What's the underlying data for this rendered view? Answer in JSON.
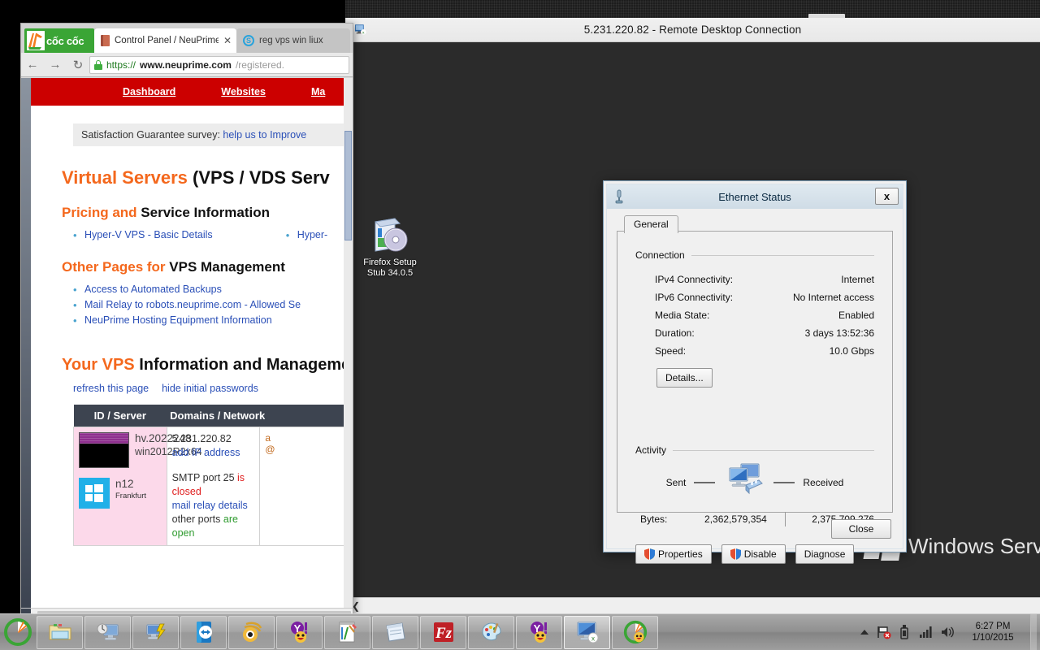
{
  "rdp": {
    "title": "5.231.220.82 - Remote Desktop Connection",
    "icon": "remote-desktop-icon",
    "desktop_icon": {
      "label_line1": "Firefox Setup",
      "label_line2": "Stub 34.0.5",
      "icon": "firefox-installer-icon"
    },
    "watermark": "Windows Serve"
  },
  "dialog": {
    "title": "Ethernet Status",
    "icon": "network-adapter-icon",
    "close_label": "x",
    "tab": "General",
    "connection": {
      "group_label": "Connection",
      "rows": [
        {
          "label": "IPv4 Connectivity:",
          "value": "Internet"
        },
        {
          "label": "IPv6 Connectivity:",
          "value": "No Internet access"
        },
        {
          "label": "Media State:",
          "value": "Enabled"
        },
        {
          "label": "Duration:",
          "value": "3 days 13:52:36"
        },
        {
          "label": "Speed:",
          "value": "10.0 Gbps"
        }
      ],
      "details_button": "Details..."
    },
    "activity": {
      "group_label": "Activity",
      "sent_label": "Sent",
      "received_label": "Received",
      "bytes_label": "Bytes:",
      "bytes_sent": "2,362,579,354",
      "bytes_received": "2,375,709,276",
      "buttons": [
        {
          "label": "Properties",
          "shield": true
        },
        {
          "label": "Disable",
          "shield": true
        },
        {
          "label": "Diagnose",
          "shield": false
        }
      ]
    },
    "close_button": "Close"
  },
  "browser": {
    "logo_text": "cốc cốc",
    "tabs": [
      {
        "label": "Control Panel / NeuPrime",
        "favicon": "book-icon",
        "active": true,
        "close": "✕"
      },
      {
        "label": "reg vps win liux",
        "favicon": "circle-s-icon",
        "active": false
      }
    ],
    "nav": {
      "back": "←",
      "forward": "→",
      "reload": "↻"
    },
    "url": {
      "scheme": "https://",
      "host": "www.neuprime.com",
      "path": "/registered.",
      "lock": "lock-icon"
    }
  },
  "page": {
    "nav_links": [
      "Dashboard",
      "Websites",
      "Ma"
    ],
    "survey": {
      "text": "Satisfaction Guarantee survey: ",
      "link": "help us to Improve"
    },
    "headings": {
      "virtual_servers_orange": "Virtual Servers",
      "virtual_servers_rest": " (VPS / VDS Serv",
      "pricing_orange": "Pricing and",
      "pricing_rest": " Service Information",
      "other_orange": "Other Pages for",
      "other_rest": " VPS Management",
      "yourvps_orange": "Your VPS",
      "yourvps_rest": " Information and Managemen"
    },
    "pricing_links_col1": [
      "Hyper-V VPS - Basic Details"
    ],
    "pricing_links_col2": [
      "Hyper-"
    ],
    "other_links": [
      "Access to Automated Backups",
      "Mail Relay to robots.neuprime.com - Allowed Se",
      "NeuPrime Hosting Equipment Information"
    ],
    "action_links": [
      "refresh this page",
      "hide initial passwords"
    ],
    "table": {
      "headers": [
        "ID / Server",
        "Domains / Network",
        ""
      ],
      "row": {
        "server_id": "hv.2022248",
        "server_os": "win2012R2x64",
        "node": "n12",
        "location": "Frankfurt",
        "ip": "5.231.220.82",
        "add_ip_link": "add IP address",
        "smtp_prefix": "SMTP port 25 ",
        "smtp_status": "is closed",
        "mail_relay_link": "mail relay details",
        "other_ports_prefix": "other ports ",
        "other_ports_status": "are open",
        "extra_line1": "a",
        "extra_line2": "@"
      }
    }
  },
  "taskbar": {
    "start": "start-orb-coccoc-icon",
    "items": [
      {
        "name": "file-explorer-icon",
        "active": false
      },
      {
        "name": "network-computer-icon",
        "active": false
      },
      {
        "name": "network-config-icon",
        "active": false
      },
      {
        "name": "teamviewer-icon",
        "active": false
      },
      {
        "name": "yahoo-messenger-eye-icon",
        "active": false
      },
      {
        "name": "yahoo-messenger-icon",
        "active": false
      },
      {
        "name": "notepad-plus-plus-icon",
        "active": false
      },
      {
        "name": "notepad-icon",
        "active": false
      },
      {
        "name": "filezilla-icon",
        "active": false
      },
      {
        "name": "paint-icon",
        "active": false
      },
      {
        "name": "yahoo-messenger-2-icon",
        "active": false
      },
      {
        "name": "remote-desktop-icon",
        "active": true
      },
      {
        "name": "coccoc-browser-icon",
        "active": false
      }
    ],
    "tray": {
      "overflow": "show-hidden-icons-arrow",
      "icons": [
        "network-flag-error-icon",
        "usb-device-icon",
        "signal-bars-icon",
        "volume-icon"
      ],
      "time": "6:27 PM",
      "date": "1/10/2015"
    }
  }
}
